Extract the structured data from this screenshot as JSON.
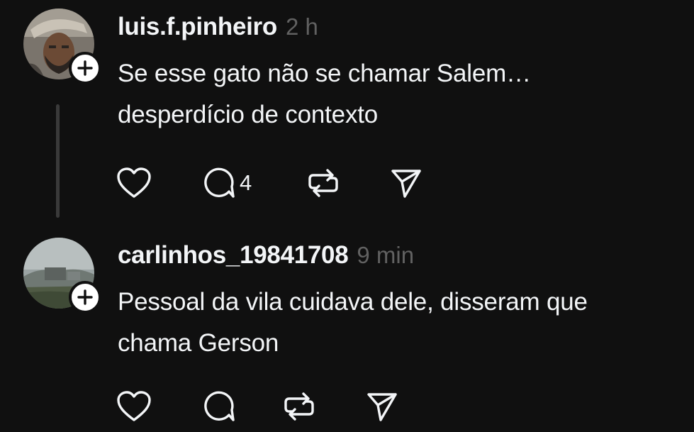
{
  "posts": [
    {
      "username": "luis.f.pinheiro",
      "time": "2 h",
      "text_lines": [
        "Se esse gato não se chamar Salem…",
        "desperdício de contexto"
      ],
      "reply_count": "4",
      "has_thread_line": true
    },
    {
      "username": "carlinhos_19841708",
      "time": "9 min",
      "text_lines": [
        "Pessoal da vila cuidava dele, disseram que",
        "chama Gerson"
      ],
      "reply_count": "",
      "has_thread_line": false
    }
  ],
  "icons": {
    "like": "heart-icon",
    "reply": "comment-bubble-icon",
    "repost": "repost-icon",
    "share": "paper-plane-icon",
    "follow": "plus-icon"
  },
  "colors": {
    "background": "#101010",
    "primary_text": "#f3f5f7",
    "secondary_text": "#616161",
    "thread_line": "#3a3a3a"
  }
}
